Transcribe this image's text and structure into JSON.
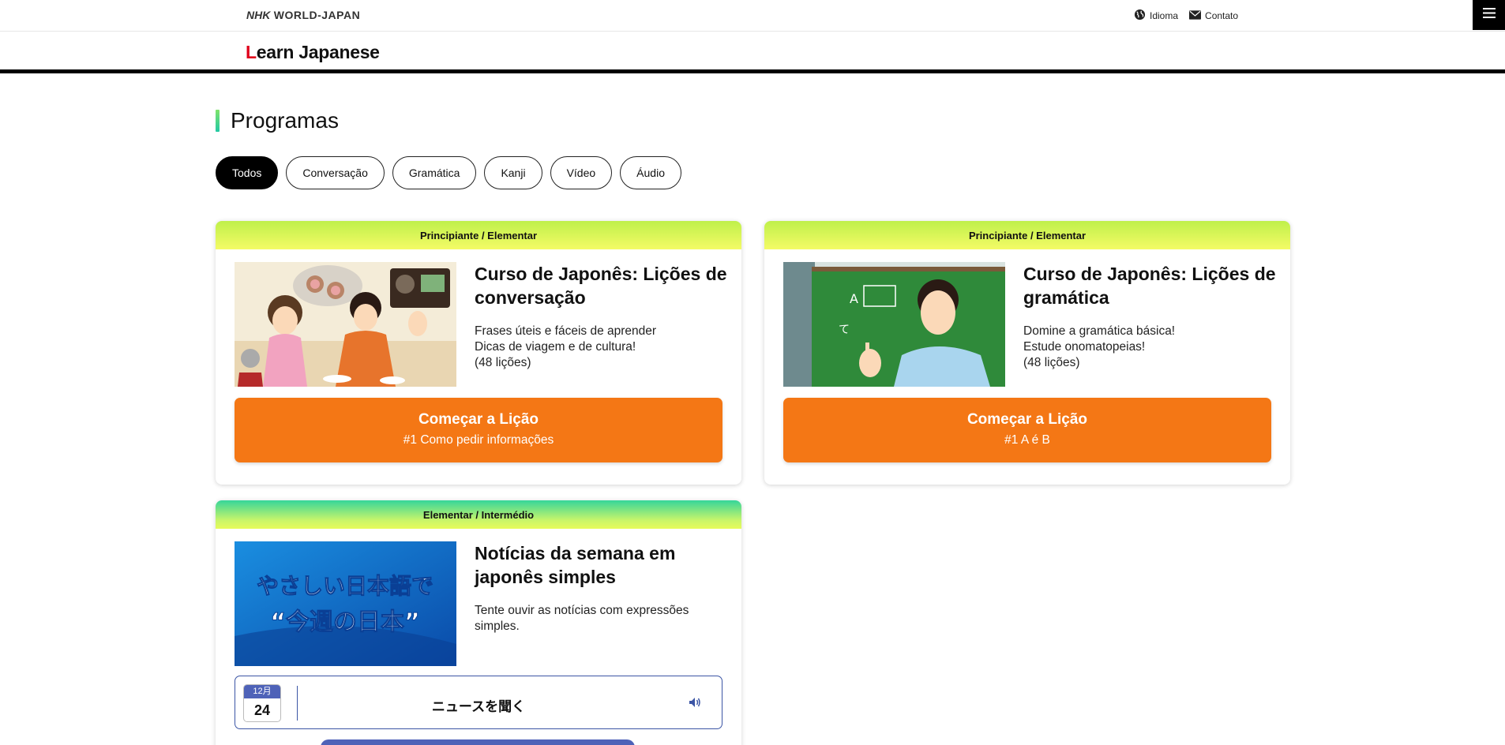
{
  "header": {
    "brand_nhk": "NHK",
    "brand_rest": " WORLD-JAPAN",
    "language_label": "Idioma",
    "contact_label": "Contato"
  },
  "subheader": {
    "title_first": "L",
    "title_rest": "earn Japanese"
  },
  "section": {
    "title": "Programas"
  },
  "filters": [
    {
      "label": "Todos",
      "active": true
    },
    {
      "label": "Conversação",
      "active": false
    },
    {
      "label": "Gramática",
      "active": false
    },
    {
      "label": "Kanji",
      "active": false
    },
    {
      "label": "Vídeo",
      "active": false
    },
    {
      "label": "Áudio",
      "active": false
    }
  ],
  "cards": [
    {
      "level": "Principiante / Elementar",
      "title": "Curso de Japonês: Lições de conversação",
      "desc_lines": [
        "Frases úteis e fáceis de aprender",
        "Dicas de viagem e de cultura!",
        "(48 lições)"
      ],
      "cta_main": "Começar a Lição",
      "cta_sub": "#1 Como pedir informações"
    },
    {
      "level": "Principiante / Elementar",
      "title": "Curso de Japonês: Lições de gramática",
      "desc_lines": [
        "Domine a gramática básica!",
        "Estude onomatopeias!",
        "(48 lições)"
      ],
      "cta_main": "Começar a Lição",
      "cta_sub": "#1 A é B"
    },
    {
      "level": "Elementar / Intermédio",
      "title": "Notícias da semana em japonês simples",
      "desc_lines": [
        "Tente ouvir as notícias com expressões",
        "simples."
      ],
      "thumb_line1": "やさしい日本語で",
      "thumb_line2": "“今週の日本”",
      "news_month": "12月",
      "news_day": "24",
      "news_label": "ニュースを聞く"
    }
  ],
  "icons": {
    "globe": "globe-icon",
    "mail": "mail-icon",
    "menu": "hamburger-menu-icon",
    "speaker": "speaker-icon"
  },
  "colors": {
    "cta_orange": "#f47715",
    "news_blue": "#3b55a5",
    "brand_red": "#e0001b"
  }
}
